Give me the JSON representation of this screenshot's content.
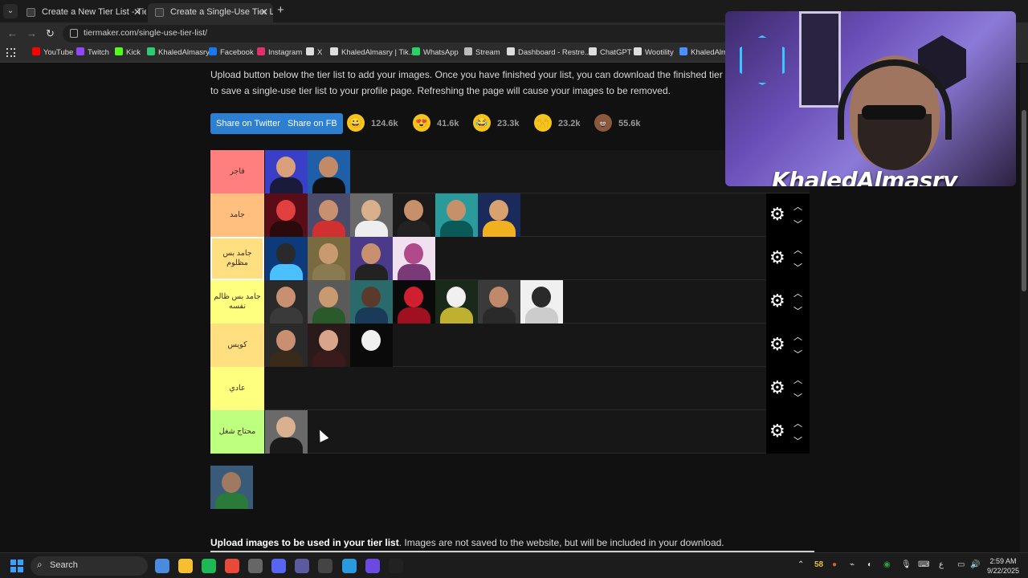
{
  "browser": {
    "tabs": [
      {
        "title": "Create a New Tier List - TierMa",
        "active": false
      },
      {
        "title": "Create a Single-Use Tier List (P",
        "active": true
      }
    ],
    "url": "tiermaker.com/single-use-tier-list/",
    "bookmarks": [
      {
        "label": "YouTube",
        "icon_color": "#ff0000"
      },
      {
        "label": "Twitch",
        "icon_color": "#9146ff"
      },
      {
        "label": "Kick",
        "icon_color": "#53fc18"
      },
      {
        "label": "KhaledAlmasry",
        "icon_color": "#2ecc71"
      },
      {
        "label": "Facebook",
        "icon_color": "#1877f2"
      },
      {
        "label": "Instagram",
        "icon_color": "#e1306c"
      },
      {
        "label": "X",
        "icon_color": "#dddddd"
      },
      {
        "label": "KhaledAlmasry | Tik...",
        "icon_color": "#dddddd"
      },
      {
        "label": "WhatsApp",
        "icon_color": "#25d366"
      },
      {
        "label": "Stream",
        "icon_color": "#bbbbbb"
      },
      {
        "label": "Dashboard - Restre...",
        "icon_color": "#dddddd"
      },
      {
        "label": "ChatGPT",
        "icon_color": "#dddddd"
      },
      {
        "label": "Wootility",
        "icon_color": "#dddddd"
      },
      {
        "label": "KhaledAlma",
        "icon_color": "#4a90ff"
      }
    ]
  },
  "page": {
    "intro_line1": "Upload button below the tier list to add your images. Once you have finished your list, you can download the finished tier list ima",
    "intro_line2": "to save a single-use tier list to your profile page. Refreshing the page will cause your images to be removed.",
    "share_twitter": "Share on Twitter",
    "share_fb": "Share on FB",
    "reactions": [
      {
        "icon": "grin-emoji",
        "glyph": "😀",
        "count": "124.6k",
        "color": "#f5c518"
      },
      {
        "icon": "heart-eyes-emoji",
        "glyph": "😍",
        "count": "41.6k",
        "color": "#f5c518"
      },
      {
        "icon": "laughing-emoji",
        "glyph": "😂",
        "count": "23.3k",
        "color": "#f5c518"
      },
      {
        "icon": "clap-emoji",
        "glyph": "🙌",
        "count": "23.2k",
        "color": "#f5c518"
      },
      {
        "icon": "poop-emoji",
        "glyph": "💩",
        "count": "55.6k",
        "color": "#8b5a3c"
      }
    ],
    "tiers": [
      {
        "label": "فاجر",
        "color": "#ff7f7f",
        "selected": false,
        "show_controls": false,
        "items": [
          {
            "bg": "#3a3fc8",
            "skin": "#d9a07a",
            "shirt": "#1a1a3a"
          },
          {
            "bg": "#1e5fa8",
            "skin": "#c28a66",
            "shirt": "#111"
          }
        ]
      },
      {
        "label": "جامد",
        "color": "#ffbf7f",
        "selected": false,
        "show_controls": true,
        "items": [
          {
            "bg": "#5a0d16",
            "skin": "#e04040",
            "shirt": "#2a0a0a"
          },
          {
            "bg": "#4a4a6a",
            "skin": "#c89070",
            "shirt": "#d13030"
          },
          {
            "bg": "#6a6a6a",
            "skin": "#d9b08c",
            "shirt": "#eeeeee"
          },
          {
            "bg": "#1a1a1a",
            "skin": "#c8906a",
            "shirt": "#222"
          },
          {
            "bg": "#2a9a9a",
            "skin": "#c8906a",
            "shirt": "#0a5a5a"
          },
          {
            "bg": "#1a2a5a",
            "skin": "#d9a070",
            "shirt": "#f0b020"
          }
        ]
      },
      {
        "label": "جامد بس مظلوم",
        "color": "#ffdf7f",
        "selected": true,
        "show_controls": true,
        "items": [
          {
            "bg": "#0d3a7a",
            "skin": "#2a2a2a",
            "shirt": "#4ac0ff"
          },
          {
            "bg": "#7a6a40",
            "skin": "#c89a70",
            "shirt": "#8a7a50"
          },
          {
            "bg": "#4a3a8a",
            "skin": "#c89070",
            "shirt": "#222"
          },
          {
            "bg": "#f0e0f0",
            "skin": "#b04a8a",
            "shirt": "#7a3a7a"
          }
        ]
      },
      {
        "label": "جامد بس ظالم نفسه",
        "color": "#ffff7f",
        "selected": false,
        "show_controls": true,
        "items": [
          {
            "bg": "#2a2a2a",
            "skin": "#c89070",
            "shirt": "#3a3a3a"
          },
          {
            "bg": "#5a5a5a",
            "skin": "#c89a70",
            "shirt": "#2a5a2a"
          },
          {
            "bg": "#2a6a6a",
            "skin": "#5a3a2a",
            "shirt": "#1a3a5a"
          },
          {
            "bg": "#0a0a0a",
            "skin": "#d02030",
            "shirt": "#a01020"
          },
          {
            "bg": "#1a2a1a",
            "skin": "#f0f0f0",
            "shirt": "#c0b030"
          },
          {
            "bg": "#3a3a3a",
            "skin": "#c08a6a",
            "shirt": "#2a2a2a"
          },
          {
            "bg": "#f0f0f0",
            "skin": "#2a2a2a",
            "shirt": "#cccccc"
          }
        ]
      },
      {
        "label": "كويس",
        "color": "#ffdf7f",
        "selected": false,
        "show_controls": true,
        "items": [
          {
            "bg": "#2a2a2a",
            "skin": "#c89070",
            "shirt": "#3a2a1a"
          },
          {
            "bg": "#2a1a1a",
            "skin": "#d9a58a",
            "shirt": "#3a1a1a"
          },
          {
            "bg": "#0a0a0a",
            "skin": "#f0f0f0",
            "shirt": "#0a0a0a"
          }
        ]
      },
      {
        "label": "عادي",
        "color": "#ffff7f",
        "selected": false,
        "show_controls": true,
        "items": []
      },
      {
        "label": "محتاج شغل",
        "color": "#bfff7f",
        "selected": false,
        "show_controls": true,
        "items": [
          {
            "bg": "#6a6a6a",
            "skin": "#d9b090",
            "shirt": "#1a1a1a"
          }
        ]
      }
    ],
    "pool_items": [
      {
        "bg": "#3a5a7a",
        "skin": "#a07a60",
        "shirt": "#2a7a3a"
      }
    ],
    "upload_bold": "Upload images to be used in your tier list",
    "upload_rest": ". Images are not saved to the website, but will be included in your download."
  },
  "webcam": {
    "overlay_name": "KhaledAlmasry"
  },
  "taskbar": {
    "search_placeholder": "Search",
    "apps": [
      {
        "name": "copilot-icon",
        "color": "#4a8adf"
      },
      {
        "name": "file-explorer-icon",
        "color": "#f5c030"
      },
      {
        "name": "spotify-icon",
        "color": "#1db954"
      },
      {
        "name": "chrome-icon",
        "color": "#e84a3a"
      },
      {
        "name": "obs-icon",
        "color": "#666666"
      },
      {
        "name": "discord-icon",
        "color": "#5865f2"
      },
      {
        "name": "app-icon",
        "color": "#5a5aa0"
      },
      {
        "name": "terminal-icon",
        "color": "#444444"
      },
      {
        "name": "store-icon",
        "color": "#2a9adf"
      },
      {
        "name": "game-icon",
        "color": "#6a4ae0"
      },
      {
        "name": "capcut-icon",
        "color": "#222222"
      }
    ],
    "tray_number": "58",
    "clock_time": "2:59 AM",
    "clock_date": "9/22/2025"
  }
}
